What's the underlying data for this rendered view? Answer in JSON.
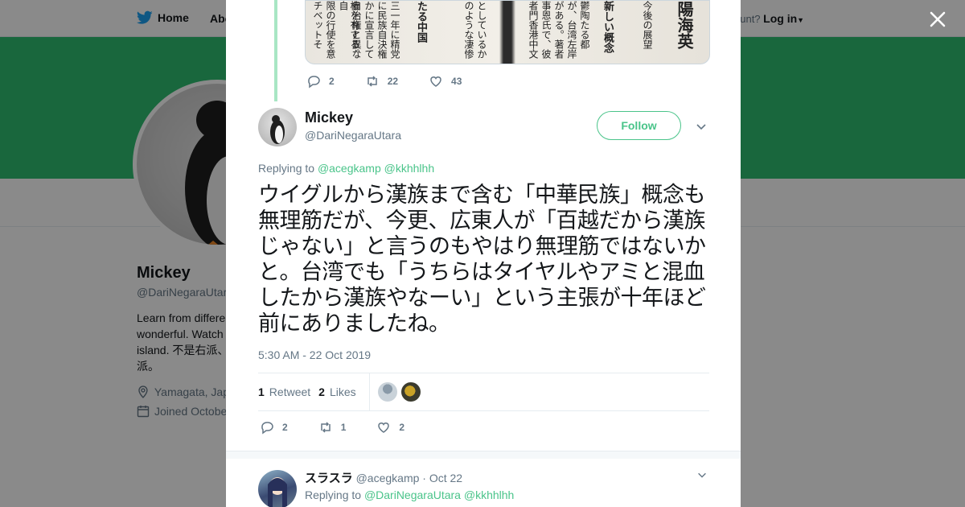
{
  "nav": {
    "home": "Home",
    "about": "Abo",
    "account_prompt": "ccount?",
    "login": "Log in"
  },
  "profile": {
    "name": "Mickey",
    "handle": "@DariNegaraUtar",
    "bio_lines": [
      "Learn from differe",
      "wonderful. Watch",
      "island. 不是右派、",
      "派。"
    ],
    "location": "Yamagata, Jap",
    "joined": "Joined Octobe"
  },
  "quoted_image_text": [
    "今後の展望",
    "新しい概念",
    "鬱陶たる都",
    "が、台湾左岸",
    "がある。著者",
    "事恩氏で、彼",
    "者門香港中文",
    "としているか",
    "のような凄惨",
    "たる中国",
    "三一年に精党",
    "に民族自決権",
    "かに宣言して",
    "自治権と異な",
    "権を有する。自",
    "限の行使を意",
    "チベットそ"
  ],
  "quoted_heading": "陽海英",
  "parent_actions": {
    "replies": "2",
    "retweets": "22",
    "likes": "43"
  },
  "tweet": {
    "name": "Mickey",
    "handle": "@DariNegaraUtara",
    "follow_label": "Follow",
    "replying_prefix": "Replying to",
    "replying_to": [
      "@acegkamp",
      "@kkhhlhh"
    ],
    "text": "ウイグルから漢族まで含む「中華民族」概念も無理筋だが、今更、広東人が「百越だから漢族じゃない」と言うのもやはり無理筋ではないかと。台湾でも「うちらはタイヤルやアミと混血したから漢族やなーい」という主張が十年ほど前にありましたね。",
    "timestamp": "5:30 AM - 22 Oct 2019",
    "retweets_count": "1",
    "retweets_label": "Retweet",
    "likes_count": "2",
    "likes_label": "Likes",
    "actions": {
      "replies": "2",
      "retweets": "1",
      "likes": "2"
    }
  },
  "reply": {
    "name": "スラスラ",
    "handle": "@acegkamp",
    "date": "· Oct 22",
    "replying_prefix": "Replying to",
    "replying_to": [
      "@DariNegaraUtara",
      "@kkhhlhh"
    ]
  },
  "colors": {
    "accent": "#4ac48a",
    "banner": "#2fbf71",
    "thread_line": "#a8e6c4"
  }
}
